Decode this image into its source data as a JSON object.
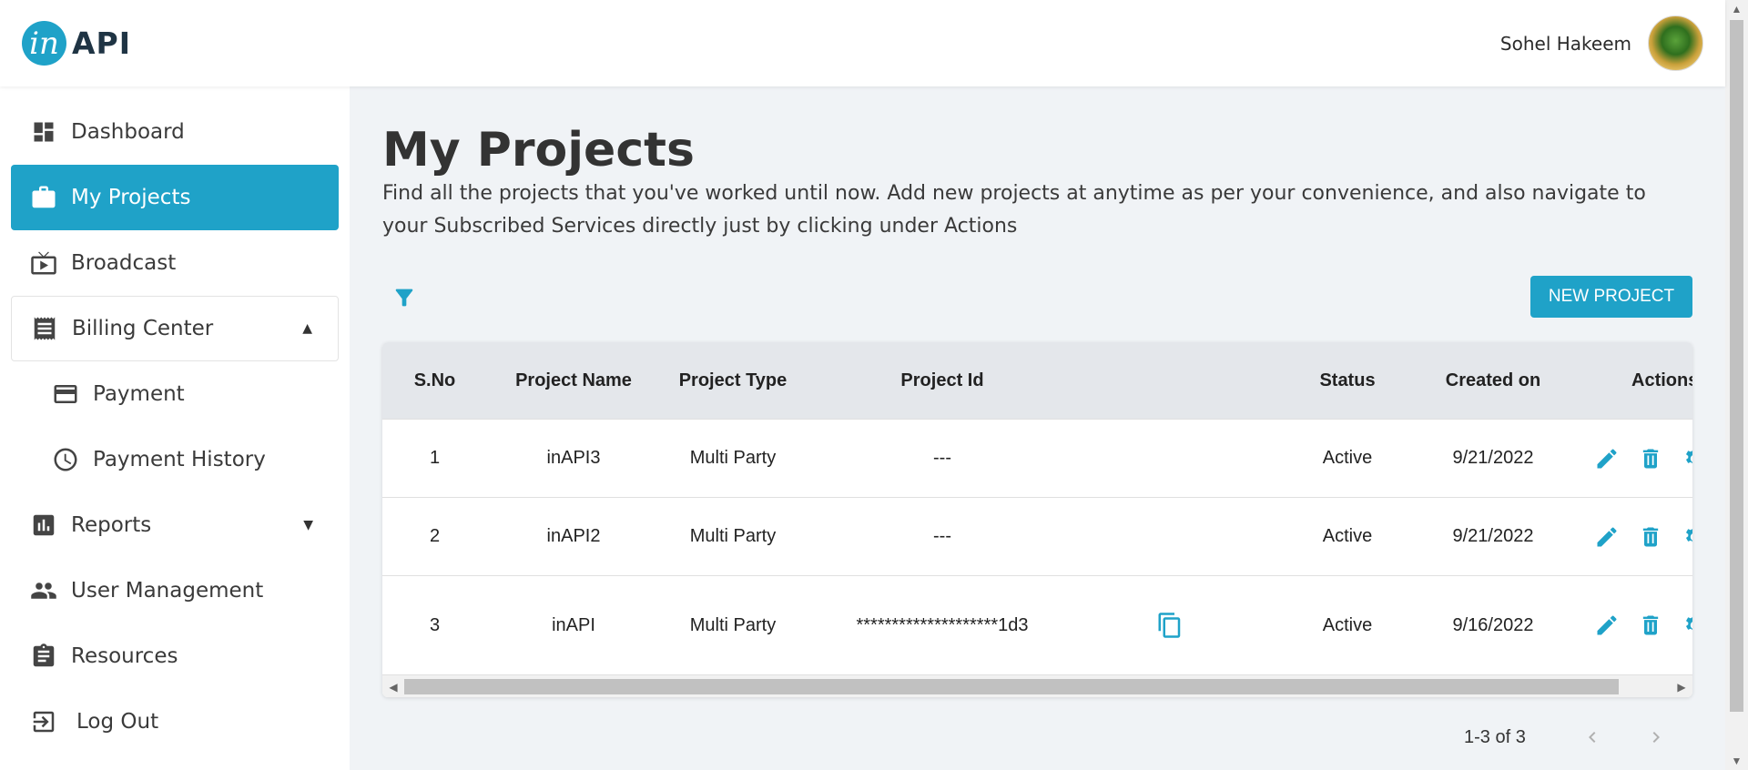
{
  "app": {
    "logo_letter": "in",
    "logo_text": "API"
  },
  "user": {
    "name": "Sohel Hakeem"
  },
  "sidebar": {
    "items": [
      {
        "label": "Dashboard",
        "icon": "dashboard-icon"
      },
      {
        "label": "My Projects",
        "icon": "briefcase-icon",
        "active": true
      },
      {
        "label": "Broadcast",
        "icon": "broadcast-icon"
      },
      {
        "label": "Billing Center",
        "icon": "receipt-icon",
        "expanded": true
      },
      {
        "label": "Payment",
        "icon": "credit-card-icon"
      },
      {
        "label": "Payment History",
        "icon": "clock-icon"
      },
      {
        "label": "Reports",
        "icon": "bar-chart-icon",
        "expanded": false
      },
      {
        "label": "User Management",
        "icon": "users-icon"
      },
      {
        "label": "Resources",
        "icon": "clipboard-icon"
      },
      {
        "label": "Log Out",
        "icon": "logout-icon"
      }
    ]
  },
  "main": {
    "title": "My Projects",
    "description": "Find all the projects that you've worked until now. Add new projects at anytime as per your convenience, and also navigate to your Subscribed Services directly just by clicking under Actions",
    "new_project_label": "NEW PROJECT"
  },
  "table": {
    "columns": [
      "S.No",
      "Project Name",
      "Project Type",
      "Project Id",
      "Status",
      "Created on",
      "Actions"
    ],
    "rows": [
      {
        "sno": "1",
        "name": "inAPI3",
        "type": "Multi Party",
        "id": "---",
        "status": "Active",
        "created": "9/21/2022"
      },
      {
        "sno": "2",
        "name": "inAPI2",
        "type": "Multi Party",
        "id": "---",
        "status": "Active",
        "created": "9/21/2022"
      },
      {
        "sno": "3",
        "name": "inAPI",
        "type": "Multi Party",
        "id": "********************1d3",
        "status": "Active",
        "created": "9/16/2022"
      }
    ]
  },
  "pagination": {
    "text": "1-3 of 3"
  },
  "colors": {
    "accent": "#1fa2c8",
    "header_bg": "#e4e7eb",
    "page_bg": "#f0f3f6"
  }
}
